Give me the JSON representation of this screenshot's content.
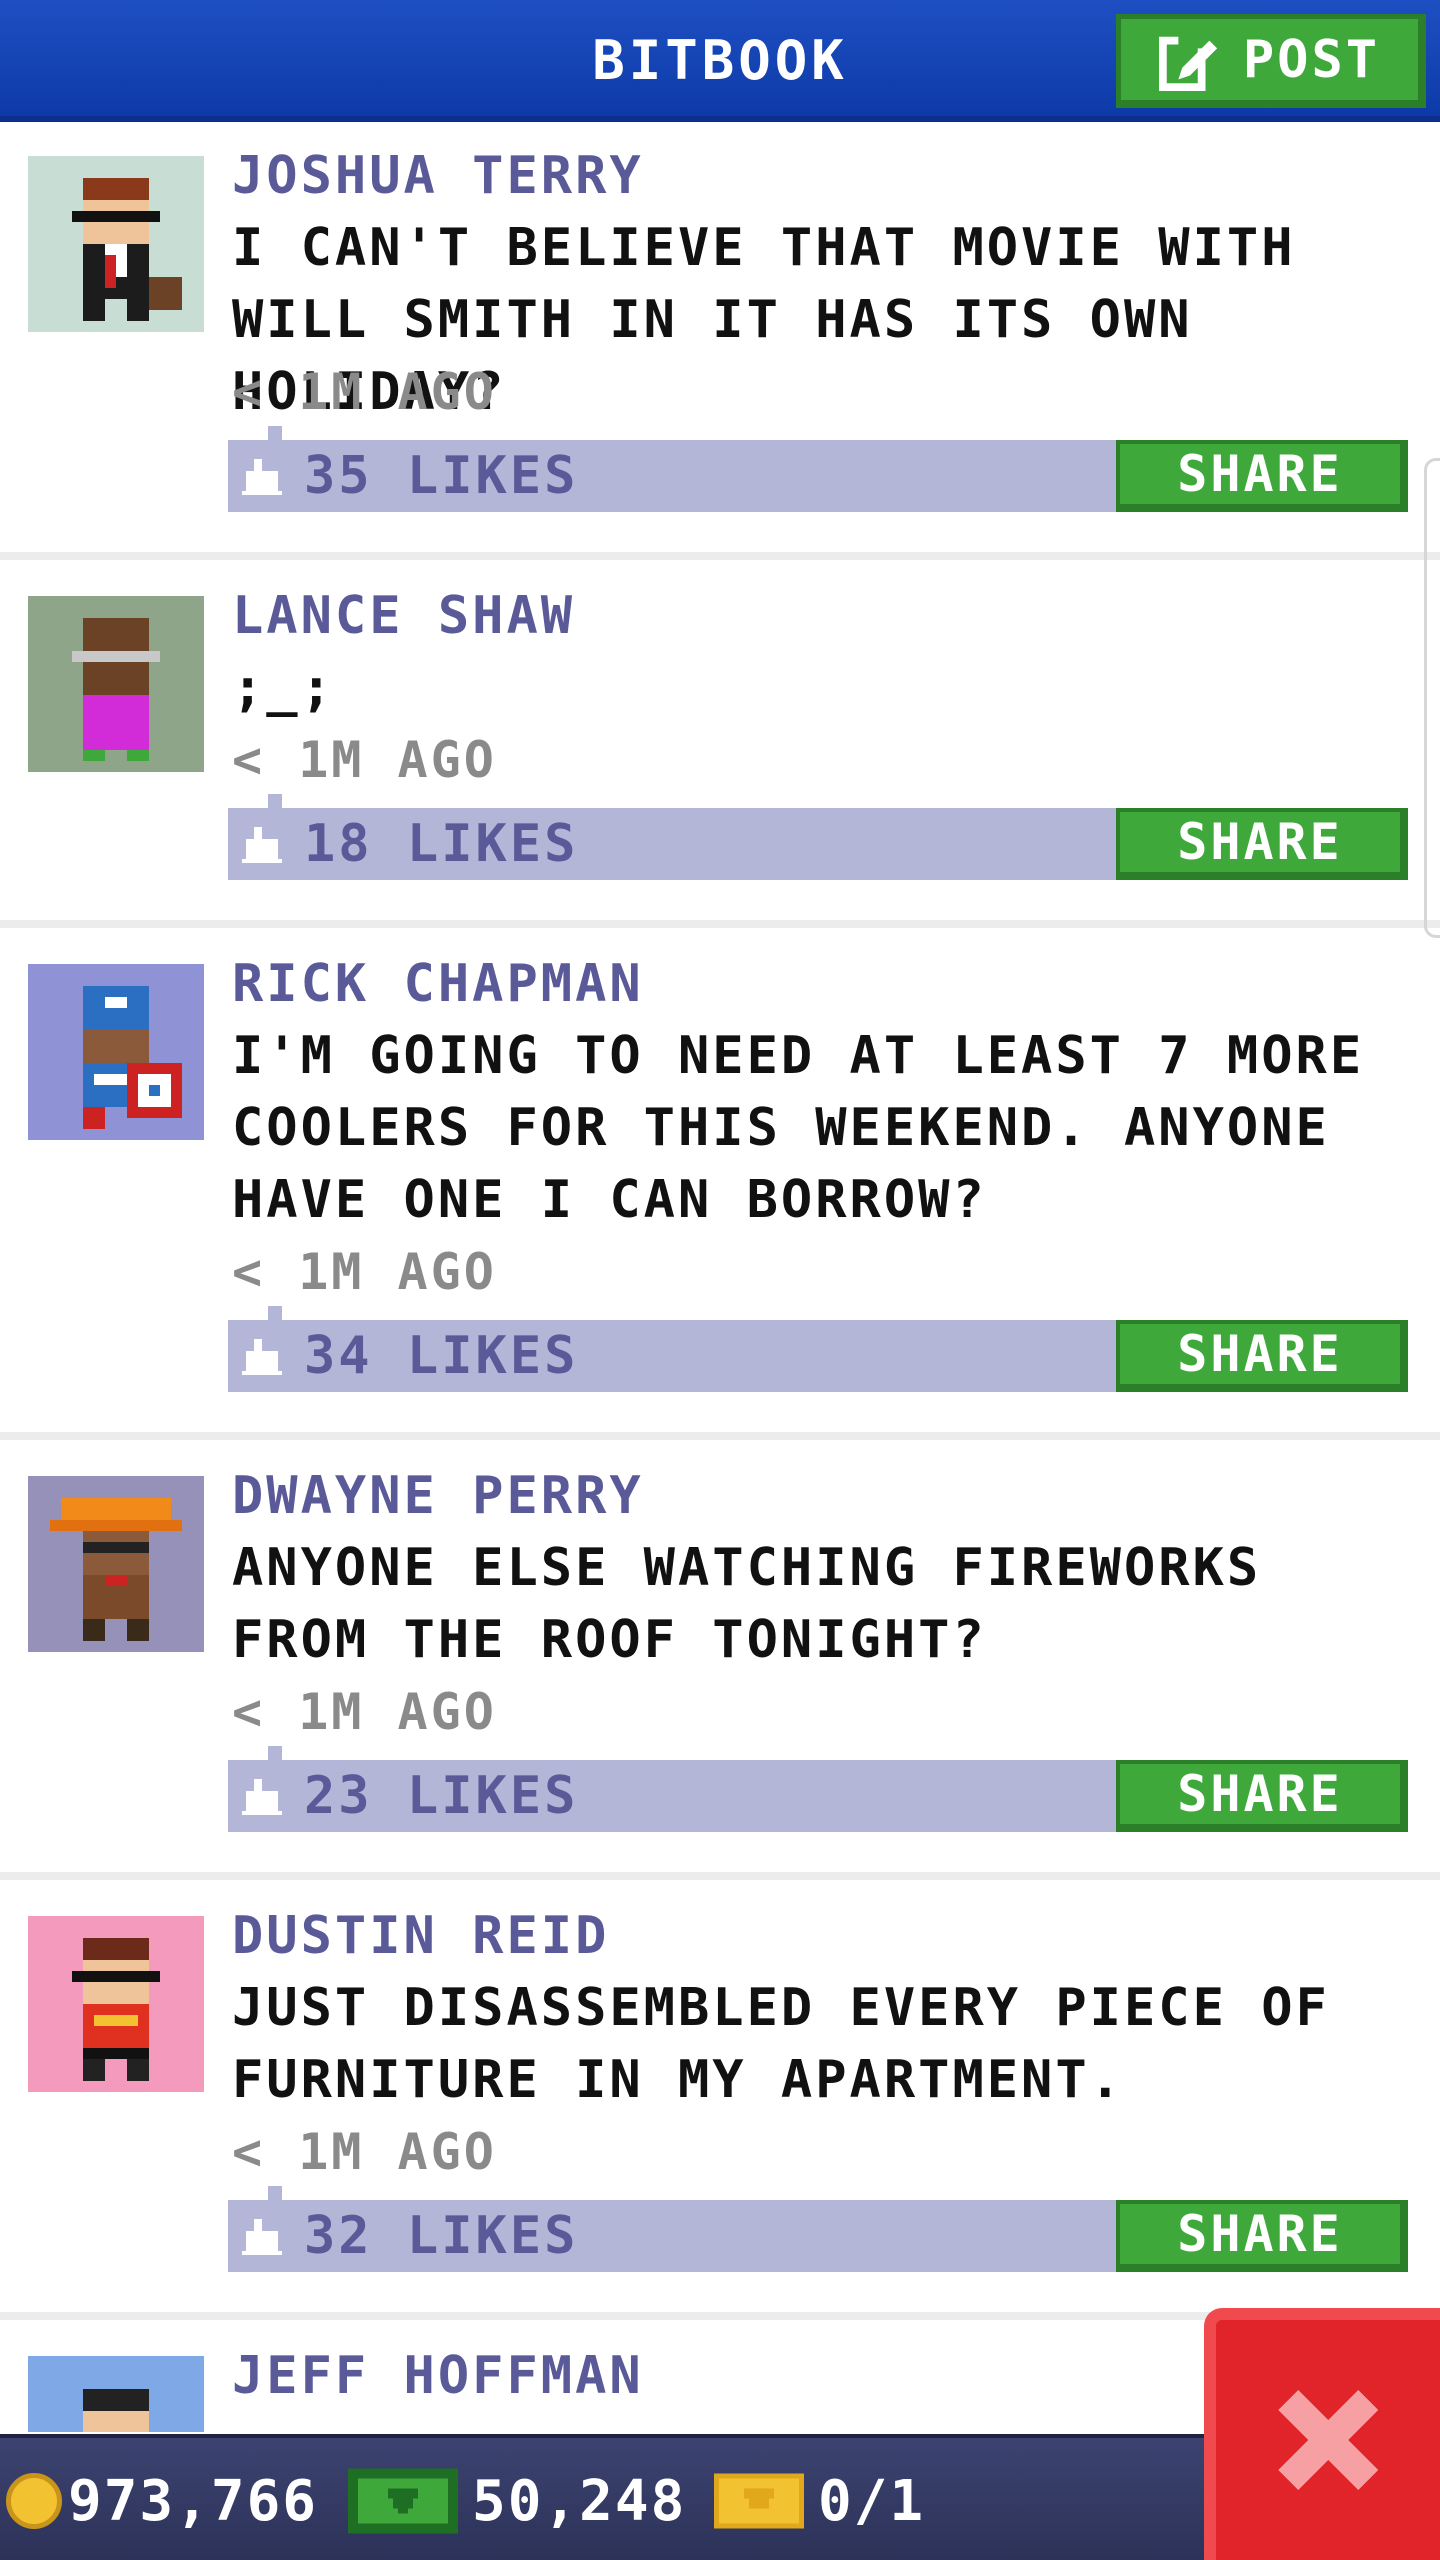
{
  "header": {
    "title": "BITBOOK",
    "post_label": "POST"
  },
  "posts": [
    {
      "author": "JOSHUA TERRY",
      "message": "I CAN'T BELIEVE THAT MOVIE WITH WILL SMITH IN IT HAS ITS OWN HOLIDAY?",
      "time": "< 1M AGO",
      "likes": "35 LIKES",
      "share_label": "SHARE",
      "avatar_bg": "#c8ddd4"
    },
    {
      "author": "LANCE SHAW",
      "message": ";_;",
      "time": "< 1M AGO",
      "likes": "18 LIKES",
      "share_label": "SHARE",
      "avatar_bg": "#8fa58a"
    },
    {
      "author": "RICK CHAPMAN",
      "message": "I'M GOING TO NEED AT LEAST 7 MORE COOLERS FOR THIS WEEKEND. ANYONE HAVE ONE I CAN BORROW?",
      "time": "< 1M AGO",
      "likes": "34 LIKES",
      "share_label": "SHARE",
      "avatar_bg": "#8f93d6"
    },
    {
      "author": "DWAYNE PERRY",
      "message": "ANYONE ELSE WATCHING FIREWORKS FROM THE ROOF TONIGHT?",
      "time": "< 1M AGO",
      "likes": "23 LIKES",
      "share_label": "SHARE",
      "avatar_bg": "#9691b9"
    },
    {
      "author": "DUSTIN REID",
      "message": "JUST DISASSEMBLED EVERY PIECE OF FURNITURE IN MY APARTMENT.",
      "time": "< 1M AGO",
      "likes": "32 LIKES",
      "share_label": "SHARE",
      "avatar_bg": "#f49bbd"
    },
    {
      "author": "JEFF HOFFMAN",
      "avatar_bg": "#7fa8e6"
    }
  ],
  "status": {
    "coins": "973,766",
    "bux": "50,248",
    "tickets": "0/1"
  },
  "colors": {
    "header": "#1e4fc2",
    "accent_green": "#3fa83b",
    "like_bar": "#b4b6d8",
    "author_text": "#5a5a98",
    "close_red": "#e0242a"
  },
  "icons": [
    "edit-icon",
    "like-icon",
    "coin-icon",
    "bux-icon",
    "ticket-icon",
    "close-icon"
  ]
}
